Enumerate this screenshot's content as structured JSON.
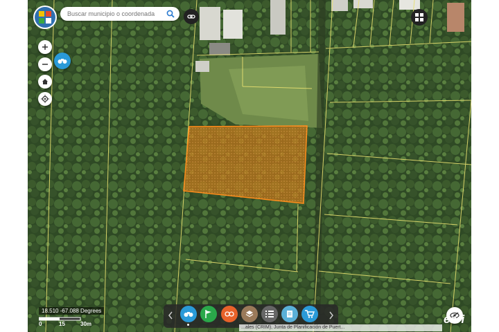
{
  "search": {
    "placeholder": "Buscar municipio o coordenada"
  },
  "status": {
    "coordinates": "18.510 -67.088 Degrees"
  },
  "scale": {
    "labels": [
      "0",
      "15",
      "30m"
    ]
  },
  "attribution": "...ales (CRIM), Junta de Planificación de Puert...",
  "brand": "esri",
  "colors": {
    "parcel_fill": "#c8781a",
    "parcel_stroke": "#ff8c1a",
    "parcel_lines": "#e8e070",
    "tool_identify": "#2a9ad8",
    "tool_flag": "#2aa84a",
    "tool_measure": "#e8622a",
    "tool_layers": "#9a7a5a",
    "tool_legend": "#666666",
    "tool_print": "#5ab0d8",
    "tool_cart": "#2a9ad8"
  },
  "toolbar": {
    "tools": [
      {
        "icon": "binoculars-icon"
      },
      {
        "icon": "flag-icon"
      },
      {
        "icon": "measure-icon"
      },
      {
        "icon": "layers-icon"
      },
      {
        "icon": "legend-list-icon"
      },
      {
        "icon": "print-icon"
      },
      {
        "icon": "cart-icon"
      }
    ]
  }
}
